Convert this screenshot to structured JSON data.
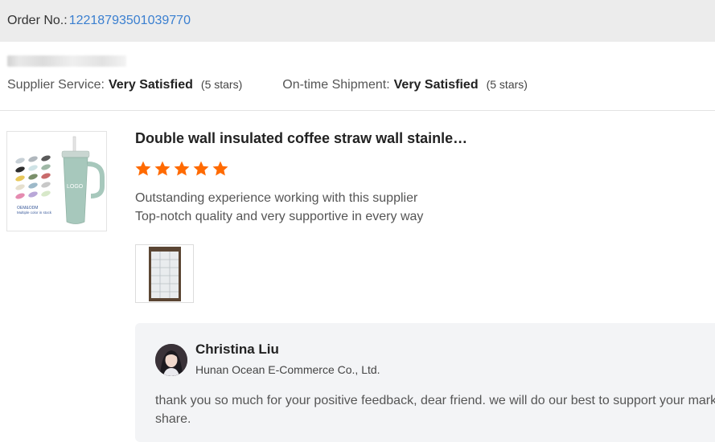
{
  "order": {
    "label": "Order No.:",
    "number": "12218793501039770"
  },
  "ratings": {
    "supplier_service": {
      "label": "Supplier Service:",
      "value": "Very Satisfied",
      "stars_text": "(5 stars)"
    },
    "on_time_shipment": {
      "label": "On-time Shipment:",
      "value": "Very Satisfied",
      "stars_text": "(5 stars)"
    }
  },
  "product": {
    "title": "Double wall insulated coffee straw wall stainle…",
    "rating": 5,
    "review_lines": [
      "Outstanding experience working with this supplier",
      "Top-notch quality and very supportive in every way"
    ],
    "thumb_caption_1": "OEM&ODM",
    "thumb_caption_2": "Multiple color in stock",
    "thumb_logo": "LOGO"
  },
  "reply": {
    "name": "Christina Liu",
    "company": "Hunan Ocean E-Commerce Co., Ltd.",
    "text": "thank you so much for your positive feedback, dear friend. we will do our best to support your market share."
  },
  "colors": {
    "star": "#ff6a00",
    "link": "#3a7fd0",
    "header_bg": "#ececec",
    "reply_bg": "#f3f4f6"
  }
}
